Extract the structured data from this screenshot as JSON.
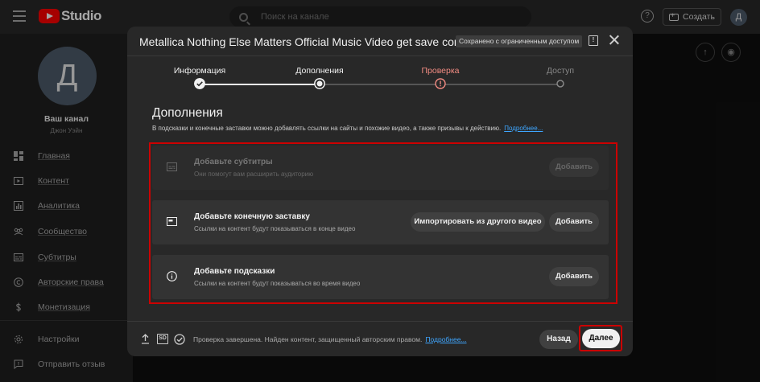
{
  "topbar": {
    "logo_text": "Studio",
    "search_placeholder": "Поиск на канале",
    "help_glyph": "?",
    "create_label": "Создать",
    "avatar_letter": "Д"
  },
  "sidebar": {
    "avatar_letter": "Д",
    "channel_label": "Ваш канал",
    "channel_name": "Джон Уэйн",
    "items": [
      {
        "label": "Главная",
        "icon": "dashboard-icon"
      },
      {
        "label": "Контент",
        "icon": "content-icon"
      },
      {
        "label": "Аналитика",
        "icon": "analytics-icon"
      },
      {
        "label": "Сообщество",
        "icon": "community-icon"
      },
      {
        "label": "Субтитры",
        "icon": "subtitles-icon"
      },
      {
        "label": "Авторские права",
        "icon": "copyright-icon"
      },
      {
        "label": "Монетизация",
        "icon": "dollar-icon"
      }
    ],
    "bottom_items": [
      {
        "label": "Настройки",
        "icon": "gear-icon"
      },
      {
        "label": "Отправить отзыв",
        "icon": "feedback-icon"
      }
    ]
  },
  "dialog": {
    "title": "Metallica Nothing Else Matters Official Music Video get save com",
    "visibility_badge": "Сохранено с ограниченным доступом",
    "steps": [
      {
        "label": "Информация",
        "state": "done"
      },
      {
        "label": "Дополнения",
        "state": "current"
      },
      {
        "label": "Проверка",
        "state": "warning"
      },
      {
        "label": "Доступ",
        "state": "pending"
      }
    ],
    "section_title": "Дополнения",
    "section_desc": "В подсказки и конечные заставки можно добавлять ссылки на сайты и похожие видео, а также призывы к действию.",
    "learn_more": "Подробнее...",
    "cards": {
      "subtitles": {
        "title": "Добавьте субтитры",
        "subtitle": "Они помогут вам расширить аудиторию",
        "button": "Добавить"
      },
      "endscreen": {
        "title": "Добавьте конечную заставку",
        "subtitle": "Ссылки на контент будут показываться в конце видео",
        "import_button": "Импортировать из другого видео",
        "button": "Добавить"
      },
      "cards": {
        "title": "Добавьте подсказки",
        "subtitle": "Ссылки на контент будут показываться во время видео",
        "button": "Добавить"
      }
    },
    "footer": {
      "sd_badge": "SD",
      "status": "Проверка завершена. Найден контент, защищенный авторским правом.",
      "learn_more": "Подробнее...",
      "back_label": "Назад",
      "next_label": "Далее"
    }
  },
  "colors": {
    "accent_red": "#cc0000",
    "warning": "#f28b82",
    "link": "#3ea6ff"
  }
}
